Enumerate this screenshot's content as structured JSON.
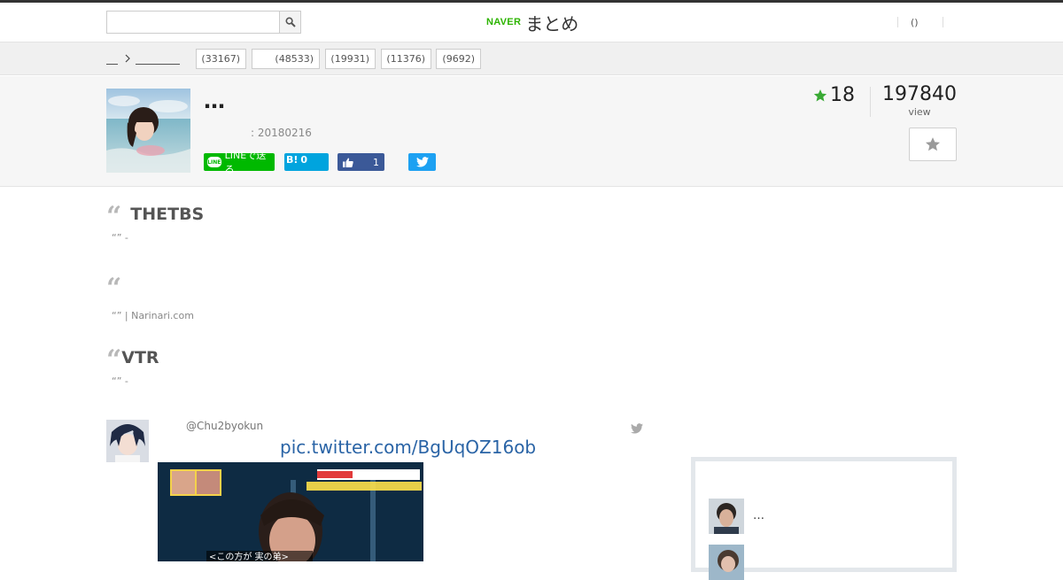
{
  "header": {
    "search_placeholder": "",
    "search_icon": "search-icon",
    "logo_naver": "NAVER",
    "logo_matome": "まとめ",
    "link_paren": "()"
  },
  "categories": {
    "chips": [
      "(33167)",
      "(48533)",
      "(19931)",
      "(11376)",
      "(9692)"
    ]
  },
  "article": {
    "title": "…",
    "date": ": 20180216",
    "share": {
      "line_label": "LINEで送る",
      "hatena_label": "B!",
      "hatena_count": "0",
      "facebook_count": "1"
    },
    "favorites": "18",
    "views": "197840",
    "views_label": "view",
    "accent_color": "#3aaa35"
  },
  "quotes": [
    {
      "title": "THETBS",
      "source": "“” -"
    },
    {
      "title": "",
      "source": "“” | Narinari.com"
    },
    {
      "title": "VTR",
      "source": "“” -"
    }
  ],
  "tweet": {
    "handle": "@Chu2byokun",
    "link": "pic.twitter.com/BgUqOZ16ob",
    "media_caption": "<この方が 実の弟>"
  },
  "sidebar": {
    "items": [
      {
        "text": "…"
      },
      {
        "text": ""
      }
    ]
  }
}
